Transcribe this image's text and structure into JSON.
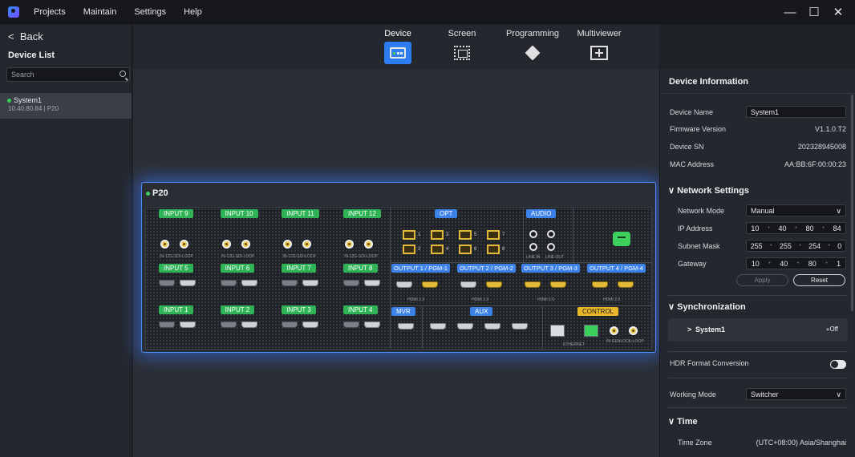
{
  "menu": {
    "items": [
      "Projects",
      "Maintain",
      "Settings",
      "Help"
    ]
  },
  "window": {
    "minimize": "—",
    "maximize": "☐",
    "close": "✕"
  },
  "left": {
    "back": "Back",
    "title": "Device List",
    "search_placeholder": "Search",
    "device": {
      "name": "System1",
      "sub": "10.40.80.84 | P20"
    }
  },
  "tabs": [
    {
      "label": "Device",
      "icon": "monitor-icon"
    },
    {
      "label": "Screen",
      "icon": "screen-grid-icon"
    },
    {
      "label": "Programming",
      "icon": "layers-icon"
    },
    {
      "label": "Multiviewer",
      "icon": "multiviewer-icon"
    }
  ],
  "device_panel": {
    "title": "P20",
    "inputs_row1": [
      "INPUT 9",
      "INPUT 10",
      "INPUT 11",
      "INPUT 12"
    ],
    "sdi_label": "IN-12G-SDI-LOOP",
    "inputs_row2": [
      "INPUT 5",
      "INPUT 6",
      "INPUT 7",
      "INPUT 8"
    ],
    "inputs_row3": [
      "INPUT 1",
      "INPUT 2",
      "INPUT 3",
      "INPUT 4"
    ],
    "opt": "OPT",
    "audio": "AUDIO",
    "audio_in": "LINE IN",
    "audio_out": "LINE OUT",
    "outputs": [
      "OUTPUT 1 / PGM-1",
      "OUTPUT 2 / PGM-2",
      "OUTPUT 3 / PGM-3",
      "OUTPUT 4 / PGM-4"
    ],
    "hdmi_label": "HDMI 2.0",
    "mvr": "MVR",
    "aux": "AUX",
    "control": "CONTROL",
    "ethernet": "ETHERNET",
    "genlock": "IN-GENLOCK-LOOP"
  },
  "info": {
    "header": "Device Information",
    "device_name_label": "Device Name",
    "device_name": "System1",
    "firmware_label": "Firmware Version",
    "firmware": "V1.1.0.T2",
    "sn_label": "Device SN",
    "sn": "202328945008",
    "mac_label": "MAC Address",
    "mac": "AA:BB:6F:00:00:23",
    "network_title": "Network Settings",
    "mode_label": "Network Mode",
    "mode": "Manual",
    "ip_label": "IP Address",
    "ip": [
      "10",
      "40",
      "80",
      "84"
    ],
    "subnet_label": "Subnet Mask",
    "subnet": [
      "255",
      "255",
      "254",
      "0"
    ],
    "gateway_label": "Gateway",
    "gateway": [
      "10",
      "40",
      "80",
      "1"
    ],
    "apply": "Apply",
    "reset": "Reset",
    "sync_title": "Synchronization",
    "sync_device": "System1",
    "sync_state": "Off",
    "hdr_label": "HDR Format Conversion",
    "working_label": "Working Mode",
    "working": "Switcher",
    "time_title": "Time",
    "tz_label": "Time Zone",
    "tz": "(UTC+08:00) Asia/Shanghai"
  }
}
